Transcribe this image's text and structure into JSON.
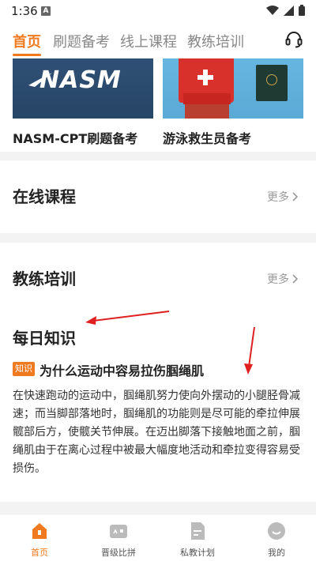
{
  "status_bar": {
    "time": "1:36",
    "notif_letter": "A"
  },
  "top_nav": {
    "tabs": [
      {
        "label": "首页"
      },
      {
        "label": "刷题备考"
      },
      {
        "label": "线上课程"
      },
      {
        "label": "教练培训"
      }
    ],
    "active_tab": "首页",
    "support_icon": "headset-icon"
  },
  "banners": [
    {
      "logo_text": "NASM",
      "label": "NASM-CPT刷题备考"
    },
    {
      "label": "游泳救生员备考"
    }
  ],
  "sections": [
    {
      "title": "在线课程",
      "more": "更多"
    },
    {
      "title": "教练培训",
      "more": "更多"
    }
  ],
  "daily_knowledge": {
    "title": "每日知识",
    "badge": "知识",
    "article_title": "为什么运动中容易拉伤腘绳肌",
    "body": "在快速跑动的运动中，腘绳肌努力使向外摆动的小腿胫骨减速；而当脚部落地时，腘绳肌的功能则是尽可能的牵拉伸展髋部后方，使髋关节伸展。在迈出脚落下接触地面之前，腘绳肌由于在离心过程中被最大幅度地活动和牵拉变得容易受损伤。"
  },
  "bottom_nav": [
    {
      "label": "首页",
      "icon": "home-icon"
    },
    {
      "label": "晋级比拼",
      "icon": "gamepad-icon"
    },
    {
      "label": "私教计划",
      "icon": "document-icon"
    },
    {
      "label": "我的",
      "icon": "smile-icon"
    }
  ],
  "colors": {
    "accent": "#f07a1f",
    "annotation": "#e02020"
  }
}
